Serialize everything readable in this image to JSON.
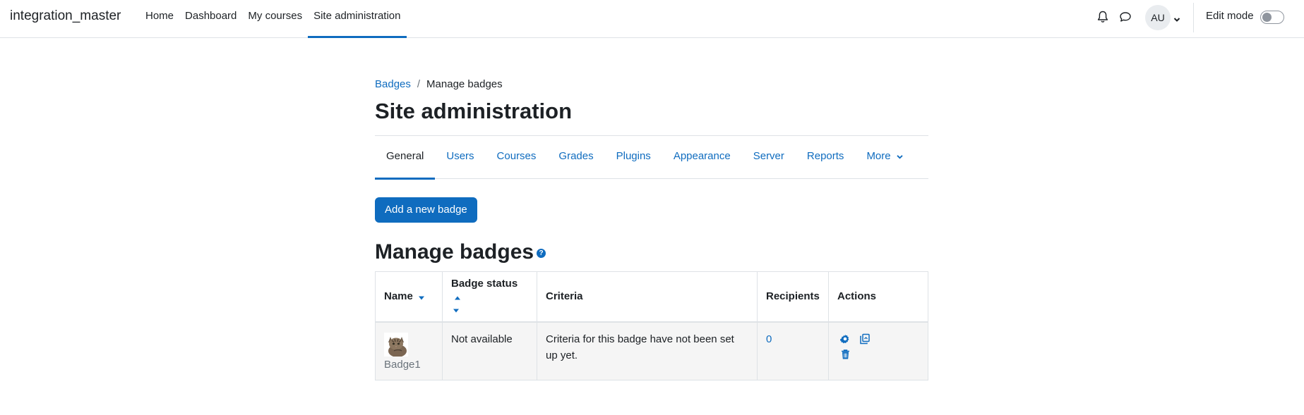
{
  "navbar": {
    "brand": "integration_master",
    "items": [
      {
        "label": "Home"
      },
      {
        "label": "Dashboard"
      },
      {
        "label": "My courses"
      },
      {
        "label": "Site administration",
        "active": true
      }
    ],
    "user_initials": "AU",
    "edit_mode_label": "Edit mode",
    "edit_mode_on": false
  },
  "breadcrumb": {
    "items": [
      "Badges",
      "Manage badges"
    ],
    "separator": "/"
  },
  "page_title": "Site administration",
  "secondary_nav": {
    "tabs": [
      {
        "label": "General",
        "active": true
      },
      {
        "label": "Users"
      },
      {
        "label": "Courses"
      },
      {
        "label": "Grades"
      },
      {
        "label": "Plugins"
      },
      {
        "label": "Appearance"
      },
      {
        "label": "Server"
      },
      {
        "label": "Reports"
      },
      {
        "label": "More"
      }
    ]
  },
  "add_badge_button": "Add a new badge",
  "section_title": "Manage badges",
  "table": {
    "headers": {
      "name": "Name",
      "status": "Badge status",
      "criteria": "Criteria",
      "recipients": "Recipients",
      "actions": "Actions"
    },
    "rows": [
      {
        "name": "Badge1",
        "status": "Not available",
        "criteria": "Criteria for this badge have not been set up yet.",
        "recipients": "0",
        "actions": [
          "settings-icon",
          "copy-icon",
          "delete-icon"
        ]
      }
    ]
  },
  "colors": {
    "primary": "#0f6cbf",
    "text": "#1d2125",
    "border": "#dee2e6",
    "row_bg": "#f5f5f5"
  }
}
